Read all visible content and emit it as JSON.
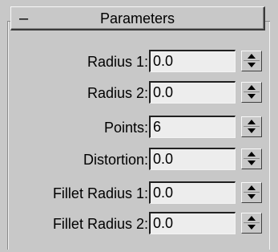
{
  "rollout": {
    "toggle_symbol": "–",
    "title": "Parameters"
  },
  "params": [
    {
      "label": "Radius 1:",
      "value": "0.0"
    },
    {
      "label": "Radius 2:",
      "value": "0.0"
    },
    {
      "label": "Points:",
      "value": "6"
    },
    {
      "label": "Distortion:",
      "value": "0.0"
    },
    {
      "label": "Fillet Radius 1:",
      "value": "0.0"
    },
    {
      "label": "Fillet Radius 2:",
      "value": "0.0"
    }
  ],
  "icons": {
    "spinner": "spinner-arrows-icon",
    "collapse": "collapse-minus-icon"
  },
  "colors": {
    "panel_bg": "#c8c8c8",
    "field_bg": "#ededed",
    "shadow": "#3a3a3a",
    "highlight": "#f8f8f8"
  }
}
